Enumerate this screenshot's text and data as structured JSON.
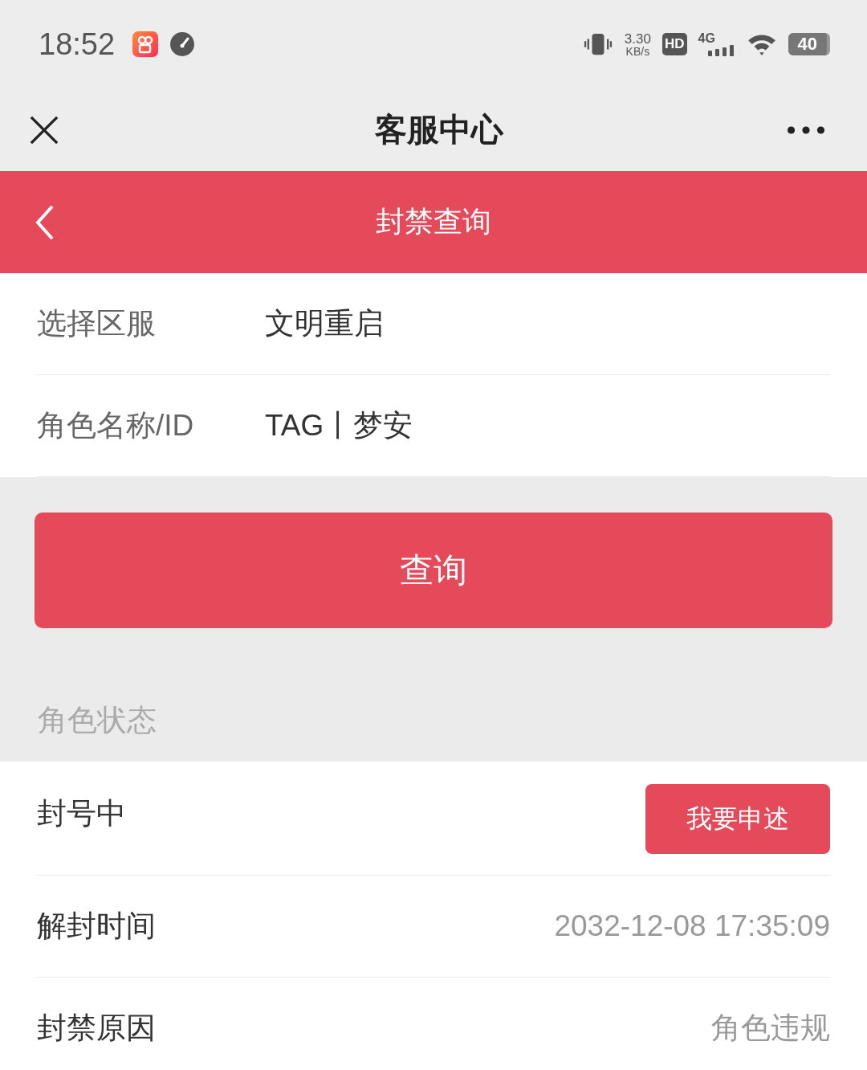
{
  "status_bar": {
    "time": "18:52",
    "speed": "3.30",
    "speed_unit": "KB/s",
    "hd": "HD",
    "network": "4G",
    "battery": "40"
  },
  "nav": {
    "title": "客服中心"
  },
  "header": {
    "title": "封禁查询"
  },
  "form": [
    {
      "label": "选择区服",
      "value": "文明重启"
    },
    {
      "label": "角色名称/ID",
      "value": "TAG丨梦安"
    }
  ],
  "query_button": "查询",
  "section_title": "角色状态",
  "status_rows": [
    {
      "kind": "action",
      "label": "封号中",
      "button": "我要申述"
    },
    {
      "kind": "text",
      "label": "解封时间",
      "value": "2032-12-08 17:35:09"
    },
    {
      "kind": "text",
      "label": "封禁原因",
      "value": "角色违规"
    }
  ]
}
